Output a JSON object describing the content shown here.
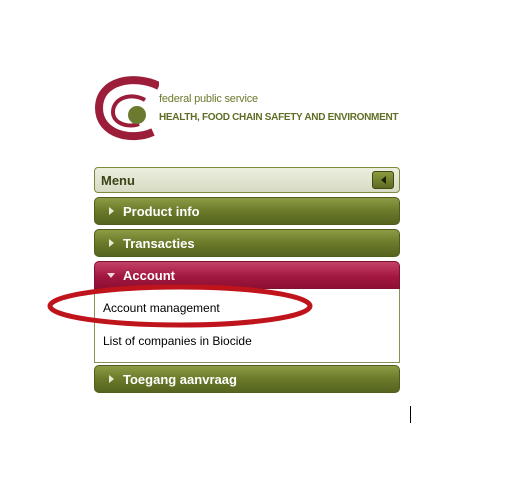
{
  "logo": {
    "line1": "federal public service",
    "line2": "HEALTH, FOOD CHAIN SAFETY AND ENVIRONMENT"
  },
  "menu": {
    "title": "Menu",
    "sections": [
      {
        "label": "Product info",
        "state": "collapsed"
      },
      {
        "label": "Transacties",
        "state": "collapsed"
      },
      {
        "label": "Account",
        "state": "expanded",
        "items": [
          "Account management",
          "List of companies in Biocide"
        ]
      },
      {
        "label": "Toegang aanvraag",
        "state": "collapsed"
      }
    ]
  },
  "colors": {
    "olive_section": "#6a7a2a",
    "active_section": "#a3173f",
    "highlight_ellipse": "#c0141c",
    "logo_maroon": "#9b1d3a"
  }
}
